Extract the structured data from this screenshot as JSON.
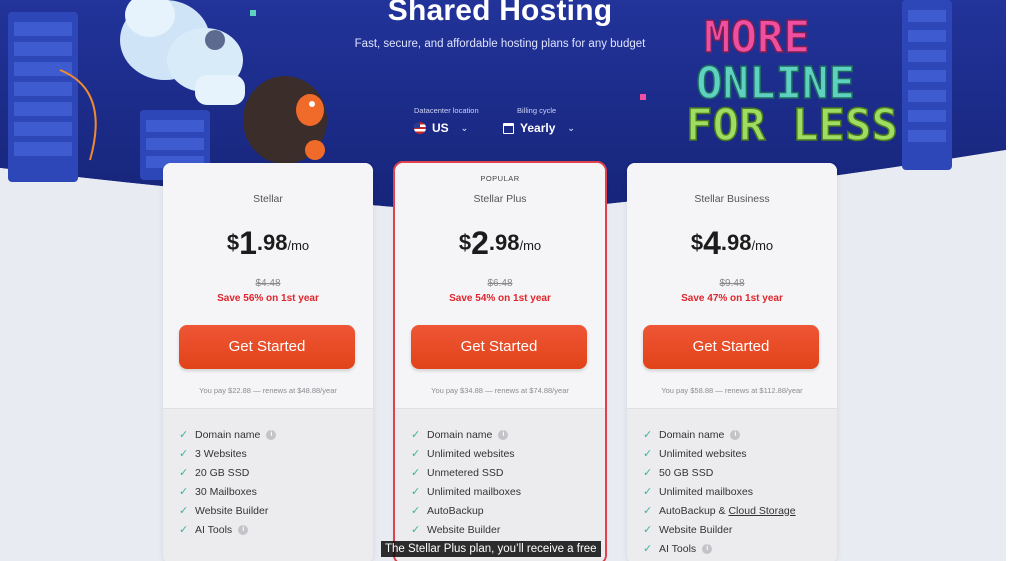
{
  "hero": {
    "title": "Shared Hosting",
    "subtitle": "Fast, secure, and affordable hosting plans for any budget",
    "art_text": [
      "MORE",
      "ONLINE",
      "FOR LESS"
    ]
  },
  "datacenter": {
    "label": "Datacenter location",
    "value": "US"
  },
  "billing": {
    "label": "Billing cycle",
    "value": "Yearly"
  },
  "plans": [
    {
      "badge": "",
      "name": "Stellar",
      "currency": "$",
      "price_int": "1",
      "price_dec": ".98",
      "per": "/mo",
      "old_price": "$4.48",
      "save": "Save 56% on 1st year",
      "cta": "Get Started",
      "fine": "You pay $22.88 — renews at $48.88/year",
      "features": [
        "Domain name",
        "3 Websites",
        "20 GB SSD",
        "30 Mailboxes",
        "Website Builder",
        "AI Tools"
      ]
    },
    {
      "badge": "POPULAR",
      "name": "Stellar Plus",
      "currency": "$",
      "price_int": "2",
      "price_dec": ".98",
      "per": "/mo",
      "old_price": "$6.48",
      "save": "Save 54% on 1st year",
      "cta": "Get Started",
      "fine": "You pay $34.88 — renews at $74.88/year",
      "features": [
        "Domain name",
        "Unlimited websites",
        "Unmetered SSD",
        "Unlimited mailboxes",
        "AutoBackup",
        "Website Builder"
      ]
    },
    {
      "badge": "",
      "name": "Stellar Business",
      "currency": "$",
      "price_int": "4",
      "price_dec": ".98",
      "per": "/mo",
      "old_price": "$9.48",
      "save": "Save 47% on 1st year",
      "cta": "Get Started",
      "fine": "You pay $58.88 — renews at $112.88/year",
      "features": [
        "Domain name",
        "Unlimited websites",
        "50 GB SSD",
        "Unlimited mailboxes",
        "AutoBackup & ",
        "Website Builder",
        "AI Tools"
      ],
      "feature_link": "Cloud Storage"
    }
  ],
  "caption": "The Stellar Plus plan, you’ll receive a free",
  "icons": [
    "check-icon",
    "info-icon",
    "us-flag-icon",
    "calendar-icon",
    "chevron-down-icon"
  ],
  "colors": {
    "hero_bg": "#1b2a8c",
    "cta": "#e8481f",
    "save": "#e0242c",
    "check": "#3bb39a",
    "popular_outline": "#e2404b"
  }
}
